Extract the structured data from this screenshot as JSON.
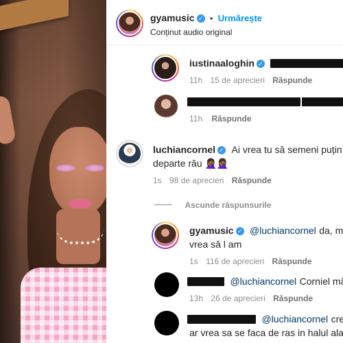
{
  "post": {
    "username": "gyamusic",
    "follow_label": "Urmărește",
    "audio_label": "Conținut audio original",
    "separator": "•"
  },
  "comments": [
    {
      "username": "iustinaaloghin",
      "text_redacted": true,
      "time": "11h",
      "likes": "15 de aprecieri",
      "reply_label": "Răspunde"
    },
    {
      "username_redacted": true,
      "text": "🐰🐰🐰🐰",
      "time": "11h",
      "reply_label": "Răspunde"
    },
    {
      "username": "luchiancornel",
      "text_line1": "Ai vrea tu să semeni puțin cu",
      "text_line2": "departe rău 🤦🏾‍♀️🤦🏾‍♀️",
      "time": "1s",
      "likes": "98 de aprecieri",
      "reply_label": "Răspunde"
    }
  ],
  "hide_replies_label": "Ascunde răspunsurile",
  "replies": [
    {
      "username": "gyamusic",
      "mention": "@luchiancornel",
      "text_line1": "da, mai",
      "text_line2": "vrea să l am",
      "time": "1s",
      "likes": "116 de aprecieri",
      "reply_label": "Răspunde"
    },
    {
      "mention": "@luchiancornel",
      "text": "Corniel mâne",
      "time": "13h",
      "likes": "26 de aprecieri",
      "reply_label": "Răspunde"
    },
    {
      "mention": "@luchiancornel",
      "text_line1": "cred",
      "text_line2": "ar vrea sa se faca de ras in halul ala s"
    }
  ],
  "icons": {
    "verified": "verified-badge-icon",
    "like": "heart-icon"
  },
  "colors": {
    "follow": "#0095f6",
    "verified": "#3897f0",
    "meta": "#8e8e8e"
  }
}
